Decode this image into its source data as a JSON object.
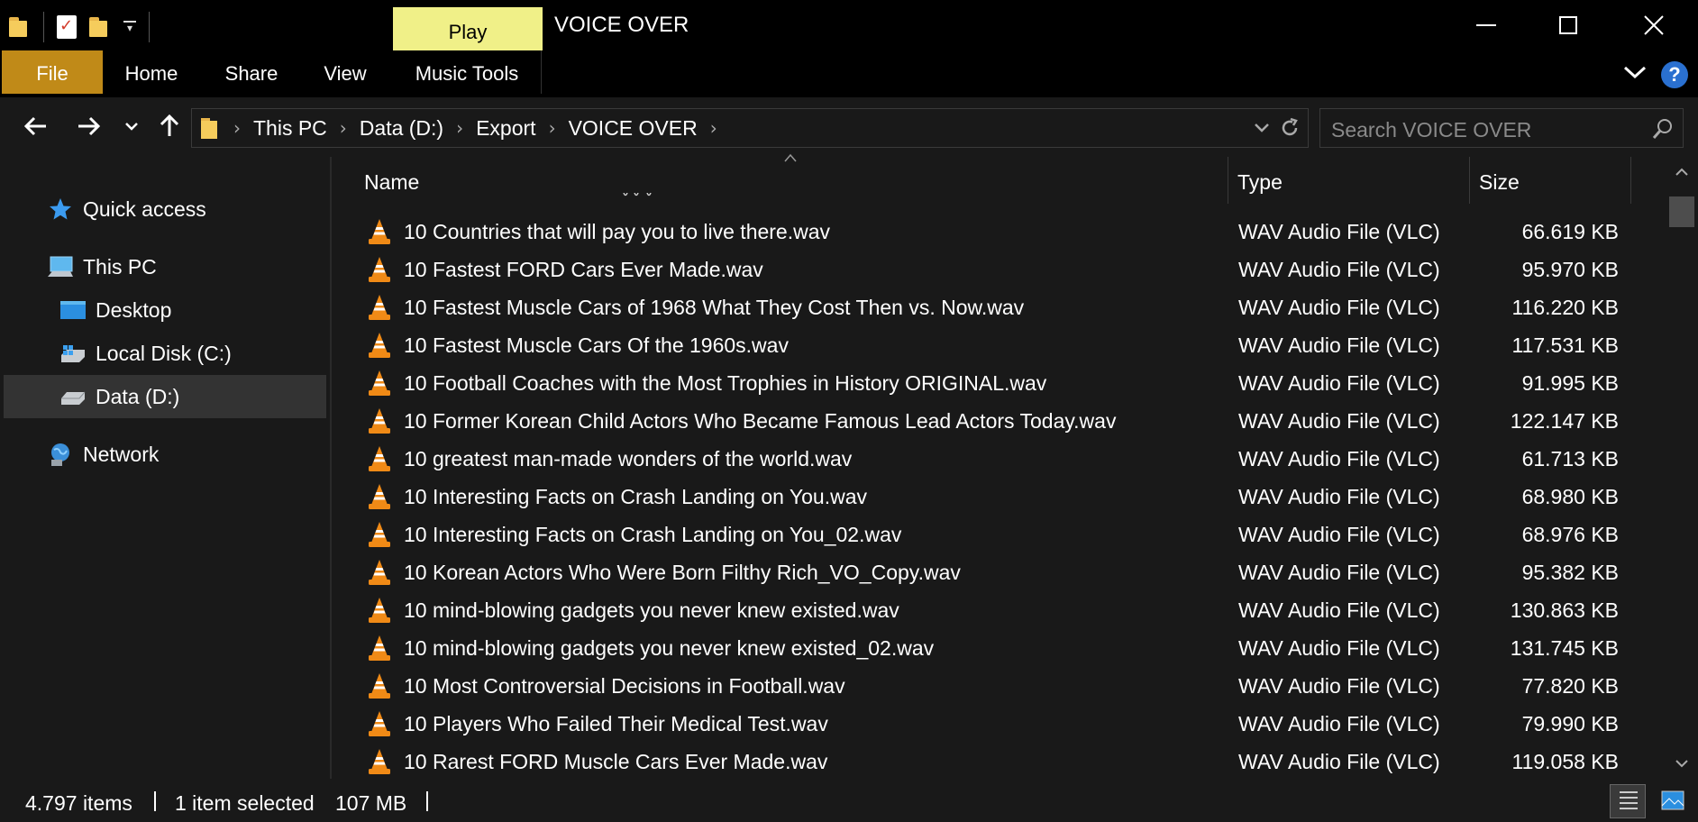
{
  "window": {
    "title": "VOICE OVER",
    "context_tab": "Play",
    "minimize_icon": "minimize-icon",
    "maximize_icon": "maximize-icon",
    "close_icon": "close-icon"
  },
  "ribbon": {
    "tabs": [
      "File",
      "Home",
      "Share",
      "View",
      "Music Tools"
    ],
    "file_color": "#c08a18",
    "context_color": "#f0f088",
    "help_label": "?"
  },
  "address": {
    "crumbs": [
      "This PC",
      "Data (D:)",
      "Export",
      "VOICE OVER"
    ],
    "search_placeholder": "Search VOICE OVER"
  },
  "sidebar": {
    "items": [
      {
        "label": "Quick access",
        "icon": "star-icon"
      },
      {
        "label": "This PC",
        "icon": "computer-icon"
      },
      {
        "label": "Desktop",
        "icon": "desktop-icon"
      },
      {
        "label": "Local Disk (C:)",
        "icon": "windows-drive-icon"
      },
      {
        "label": "Data (D:)",
        "icon": "drive-icon",
        "selected": true
      },
      {
        "label": "Network",
        "icon": "network-icon"
      }
    ]
  },
  "columns": {
    "name": "Name",
    "type": "Type",
    "size": "Size"
  },
  "files": [
    {
      "name": "10 Countries that will pay you to live there.wav",
      "type": "WAV Audio File (VLC)",
      "size": "66.619 KB"
    },
    {
      "name": "10 Fastest FORD Cars Ever Made.wav",
      "type": "WAV Audio File (VLC)",
      "size": "95.970 KB"
    },
    {
      "name": "10 Fastest Muscle Cars of 1968  What They Cost Then vs. Now.wav",
      "type": "WAV Audio File (VLC)",
      "size": "116.220 KB"
    },
    {
      "name": "10 Fastest Muscle Cars Of the 1960s.wav",
      "type": "WAV Audio File (VLC)",
      "size": "117.531 KB"
    },
    {
      "name": "10 Football Coaches with the Most Trophies in History ORIGINAL.wav",
      "type": "WAV Audio File (VLC)",
      "size": "91.995 KB"
    },
    {
      "name": "10 Former Korean Child Actors Who Became Famous Lead Actors Today.wav",
      "type": "WAV Audio File (VLC)",
      "size": "122.147 KB"
    },
    {
      "name": "10 greatest man-made wonders of the world.wav",
      "type": "WAV Audio File (VLC)",
      "size": "61.713 KB"
    },
    {
      "name": "10 Interesting Facts on Crash Landing on You.wav",
      "type": "WAV Audio File (VLC)",
      "size": "68.980 KB"
    },
    {
      "name": "10 Interesting Facts on Crash Landing on You_02.wav",
      "type": "WAV Audio File (VLC)",
      "size": "68.976 KB"
    },
    {
      "name": "10 Korean Actors Who Were Born Filthy Rich_VO_Copy.wav",
      "type": "WAV Audio File (VLC)",
      "size": "95.382 KB"
    },
    {
      "name": "10 mind-blowing gadgets you never knew existed.wav",
      "type": "WAV Audio File (VLC)",
      "size": "130.863 KB"
    },
    {
      "name": "10 mind-blowing gadgets you never knew existed_02.wav",
      "type": "WAV Audio File (VLC)",
      "size": "131.745 KB"
    },
    {
      "name": "10 Most Controversial Decisions in Football.wav",
      "type": "WAV Audio File (VLC)",
      "size": "77.820 KB"
    },
    {
      "name": "10 Players Who Failed Their Medical Test.wav",
      "type": "WAV Audio File (VLC)",
      "size": "79.990 KB"
    },
    {
      "name": "10 Rarest FORD Muscle Cars Ever Made.wav",
      "type": "WAV Audio File (VLC)",
      "size": "119.058 KB"
    }
  ],
  "status": {
    "item_count": "4.797 items",
    "selection": "1 item selected",
    "selection_size": "107 MB"
  }
}
